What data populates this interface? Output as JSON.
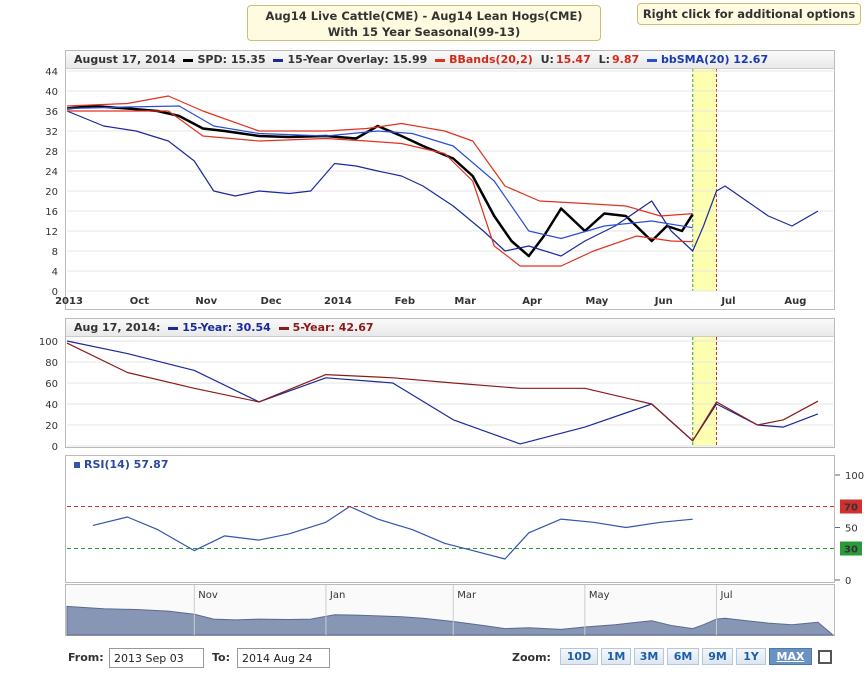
{
  "title": {
    "line1": "Aug14 Live Cattle(CME) - Aug14 Lean Hogs(CME)",
    "line2": "With 15 Year Seasonal(99-13)"
  },
  "right_click_label": "Right click for additional options",
  "main_legend": {
    "date": "August 17, 2014",
    "spd": "SPD: 15.35",
    "overlay": "15-Year Overlay: 15.99",
    "bbands": "BBands(20,2)",
    "bb_u_label": "U:",
    "bb_u": "15.47",
    "bb_l_label": "L:",
    "bb_l": "9.87",
    "bbsma": "bbSMA(20) 12.67"
  },
  "seasonal_legend": {
    "date": "Aug 17, 2014:",
    "y15": "15-Year: 30.54",
    "y5": "5-Year: 42.67"
  },
  "rsi_legend": "RSI(14) 57.87",
  "from_label": "From:",
  "from_value": "2013 Sep 03",
  "to_label": "To:",
  "to_value": "2014 Aug 24",
  "zoom_label": "Zoom:",
  "zoom_buttons": [
    "10D",
    "1M",
    "3M",
    "6M",
    "9M",
    "1Y",
    "MAX"
  ],
  "colors": {
    "spd": "#000000",
    "overlay": "#1a2a9a",
    "bbands": "#e0321e",
    "bbsma": "#2a4fd6",
    "y15": "#1a2a9a",
    "y5": "#8b1a1a",
    "rsi": "#3355aa"
  },
  "chart_data": [
    {
      "type": "line",
      "title": "Aug14 Live Cattle(CME) - Aug14 Lean Hogs(CME) With 15 Year Seasonal(99-13)",
      "x_ticks": [
        "2013",
        "Oct",
        "Nov",
        "Dec",
        "2014",
        "Feb",
        "Mar",
        "Apr",
        "May",
        "Jun",
        "Jul",
        "Aug"
      ],
      "y_ticks": [
        0,
        4,
        8,
        12,
        16,
        20,
        24,
        28,
        32,
        36,
        40,
        44
      ],
      "ylim": [
        0,
        44
      ],
      "grid": true,
      "series": [
        {
          "name": "SPD",
          "x": [
            "2013-09-03",
            "2013-09-15",
            "2013-10-01",
            "2013-10-15",
            "2013-10-25",
            "2013-11-05",
            "2013-11-15",
            "2013-12-01",
            "2013-12-15",
            "2014-01-01",
            "2014-01-15",
            "2014-01-25",
            "2014-02-05",
            "2014-02-15",
            "2014-03-01",
            "2014-03-10",
            "2014-03-20",
            "2014-03-28",
            "2014-04-05",
            "2014-04-12",
            "2014-04-20",
            "2014-05-01",
            "2014-05-10",
            "2014-05-20",
            "2014-06-01",
            "2014-06-08",
            "2014-06-15",
            "2014-06-20"
          ],
          "values": [
            36.5,
            37,
            36.5,
            36,
            35,
            32.5,
            32,
            31,
            30.8,
            31,
            30.5,
            33,
            31,
            29,
            26.5,
            23,
            15,
            10,
            7,
            11,
            16.5,
            12,
            15.5,
            15,
            10,
            13,
            12,
            15.35
          ]
        },
        {
          "name": "15-Year Overlay",
          "x": [
            "2013-09-03",
            "2013-09-20",
            "2013-10-05",
            "2013-10-20",
            "2013-11-01",
            "2013-11-10",
            "2013-11-20",
            "2013-12-01",
            "2013-12-15",
            "2013-12-25",
            "2014-01-05",
            "2014-01-15",
            "2014-01-25",
            "2014-02-05",
            "2014-02-15",
            "2014-03-01",
            "2014-03-15",
            "2014-03-25",
            "2014-04-05",
            "2014-04-20",
            "2014-05-01",
            "2014-05-15",
            "2014-06-01",
            "2014-06-10",
            "2014-06-20",
            "2014-06-25",
            "2014-07-01",
            "2014-07-05",
            "2014-07-15",
            "2014-07-25",
            "2014-08-05",
            "2014-08-17"
          ],
          "values": [
            36,
            33,
            32,
            30,
            26,
            20,
            19,
            20,
            19.5,
            20,
            25.5,
            25,
            24,
            23,
            21,
            17,
            12,
            8,
            9,
            7,
            10,
            13,
            18,
            12,
            8,
            13,
            20,
            21,
            18,
            15,
            13,
            15.99
          ]
        },
        {
          "name": "BBands Upper",
          "x": [
            "2013-09-03",
            "2013-10-01",
            "2013-10-20",
            "2013-11-05",
            "2013-12-01",
            "2014-01-01",
            "2014-01-20",
            "2014-02-05",
            "2014-02-25",
            "2014-03-10",
            "2014-03-25",
            "2014-04-10",
            "2014-05-01",
            "2014-05-20",
            "2014-06-05",
            "2014-06-20"
          ],
          "values": [
            37,
            37.5,
            39,
            36,
            32,
            32,
            32.5,
            33.5,
            32,
            30,
            21,
            18,
            17.5,
            17,
            15,
            15.47
          ]
        },
        {
          "name": "BBands Lower",
          "x": [
            "2013-09-03",
            "2013-10-01",
            "2013-10-20",
            "2013-11-05",
            "2013-12-01",
            "2014-01-01",
            "2014-01-20",
            "2014-02-05",
            "2014-02-25",
            "2014-03-10",
            "2014-03-20",
            "2014-04-01",
            "2014-04-20",
            "2014-05-05",
            "2014-05-25",
            "2014-06-10",
            "2014-06-20"
          ],
          "values": [
            36,
            36,
            36,
            31,
            30,
            30.5,
            30,
            29.5,
            27.5,
            22,
            9,
            5,
            5,
            8,
            11,
            10,
            9.87
          ]
        },
        {
          "name": "bbSMA(20)",
          "x": [
            "2013-09-03",
            "2013-10-01",
            "2013-10-25",
            "2013-11-10",
            "2013-12-01",
            "2014-01-01",
            "2014-01-25",
            "2014-02-10",
            "2014-03-01",
            "2014-03-20",
            "2014-04-05",
            "2014-04-20",
            "2014-05-10",
            "2014-06-01",
            "2014-06-20"
          ],
          "values": [
            36.5,
            36.8,
            37,
            33,
            31.5,
            31,
            32,
            31.5,
            29,
            22,
            12,
            10.5,
            13,
            14,
            12.67
          ]
        }
      ]
    },
    {
      "type": "line",
      "y_ticks": [
        0,
        20,
        40,
        60,
        80,
        100
      ],
      "ylim": [
        0,
        100
      ],
      "grid": true,
      "series": [
        {
          "name": "15-Year",
          "x": [
            "2013-09-03",
            "2013-10-01",
            "2013-11-01",
            "2013-12-01",
            "2014-01-01",
            "2014-02-01",
            "2014-03-01",
            "2014-04-01",
            "2014-05-01",
            "2014-06-01",
            "2014-06-20",
            "2014-07-01",
            "2014-07-20",
            "2014-08-01",
            "2014-08-17"
          ],
          "values": [
            100,
            88,
            72,
            42,
            65,
            60,
            25,
            2,
            18,
            40,
            5,
            40,
            20,
            18,
            30.54
          ]
        },
        {
          "name": "5-Year",
          "x": [
            "2013-09-03",
            "2013-10-01",
            "2013-11-01",
            "2013-12-01",
            "2014-01-01",
            "2014-02-01",
            "2014-03-01",
            "2014-04-01",
            "2014-05-01",
            "2014-06-01",
            "2014-06-20",
            "2014-07-01",
            "2014-07-20",
            "2014-08-01",
            "2014-08-17"
          ],
          "values": [
            98,
            70,
            55,
            42,
            68,
            65,
            60,
            55,
            55,
            40,
            5,
            42,
            20,
            25,
            42.67
          ]
        }
      ]
    },
    {
      "type": "line",
      "y_ticks": [
        0,
        50,
        100
      ],
      "ylim": [
        0,
        100
      ],
      "reference_lines": [
        70,
        30
      ],
      "series": [
        {
          "name": "RSI(14)",
          "x": [
            "2013-09-15",
            "2013-10-01",
            "2013-10-15",
            "2013-11-01",
            "2013-11-15",
            "2013-12-01",
            "2013-12-15",
            "2014-01-01",
            "2014-01-12",
            "2014-01-25",
            "2014-02-10",
            "2014-02-25",
            "2014-03-10",
            "2014-03-25",
            "2014-04-05",
            "2014-04-20",
            "2014-05-05",
            "2014-05-20",
            "2014-06-05",
            "2014-06-20"
          ],
          "values": [
            52,
            60,
            48,
            28,
            42,
            38,
            44,
            55,
            70,
            58,
            48,
            35,
            28,
            20,
            45,
            58,
            55,
            50,
            55,
            57.87
          ]
        }
      ]
    }
  ],
  "navigator_labels": [
    "Nov",
    "Jan",
    "Mar",
    "May",
    "Jul"
  ]
}
